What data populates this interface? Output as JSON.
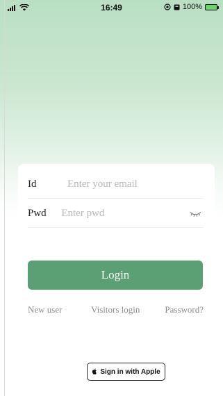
{
  "status_bar": {
    "time": "16:49",
    "battery_percent": "100%",
    "battery_level": 1.0,
    "signal_icon": "signal-bars-icon",
    "wifi_icon": "wifi-icon",
    "alarm_icon": "alarm-icon",
    "location_icon": "location-icon"
  },
  "login_form": {
    "id_label": "Id",
    "id_placeholder": "Enter your email",
    "pwd_label": "Pwd",
    "pwd_placeholder": "Enter pwd",
    "toggle_visibility_icon": "eye-closed-icon"
  },
  "login_button": {
    "label": "Login"
  },
  "links": {
    "new_user": "New user",
    "visitors_login": "Visitors login",
    "password": "Password?"
  },
  "apple_signin": {
    "label": "Sign in with Apple",
    "icon": "apple-icon"
  },
  "colors": {
    "accent": "#5b9f74",
    "gradient_top": "#b9dfc3",
    "link_text": "#8a8a8a",
    "placeholder": "#b8b8b8"
  }
}
